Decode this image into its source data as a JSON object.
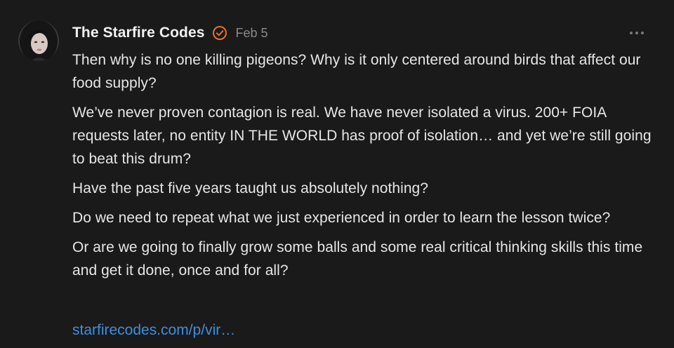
{
  "post": {
    "author": "The Starfire Codes",
    "date": "Feb 5",
    "paragraphs": [
      "Then why is no one killing pigeons? Why is it only centered around birds that affect our food supply?",
      "We’ve never proven contagion is real. We have never isolated a virus. 200+ FOIA requests later, no entity IN THE WORLD has proof of isolation… and yet we’re still going to beat this drum?",
      "Have the past five years taught us absolutely nothing?",
      "Do we need to repeat what we just experienced in order to learn the lesson twice?",
      "Or are we going to finally grow some balls and some real critical thinking skills this time and get it done, once and for all?"
    ],
    "link_text": "starfirecodes.com/p/vir…"
  },
  "icons": {
    "verified": "verified-badge-icon",
    "more": "more-options-icon"
  },
  "colors": {
    "background": "#1a1a1a",
    "text": "#e6e6e6",
    "muted": "#8a8a8a",
    "link": "#3d8fe0",
    "verified_badge": "#e8712e"
  }
}
